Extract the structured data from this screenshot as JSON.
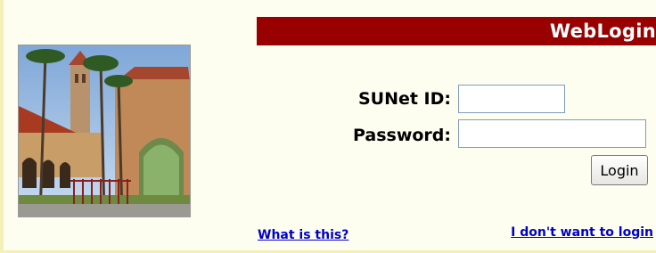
{
  "banner": {
    "title": "WebLogin"
  },
  "form": {
    "user_label": "SUNet ID:",
    "password_label": "Password:",
    "user_value": "",
    "password_value": "",
    "login_label": "Login"
  },
  "links": {
    "what_is_this": "What is this?",
    "no_login": "I don't want to login"
  },
  "colors": {
    "banner_bg": "#990000",
    "page_bg": "#fdfdf0",
    "link": "#0000cc"
  },
  "icons": {
    "campus_photo": "stanford-campus-photo"
  }
}
